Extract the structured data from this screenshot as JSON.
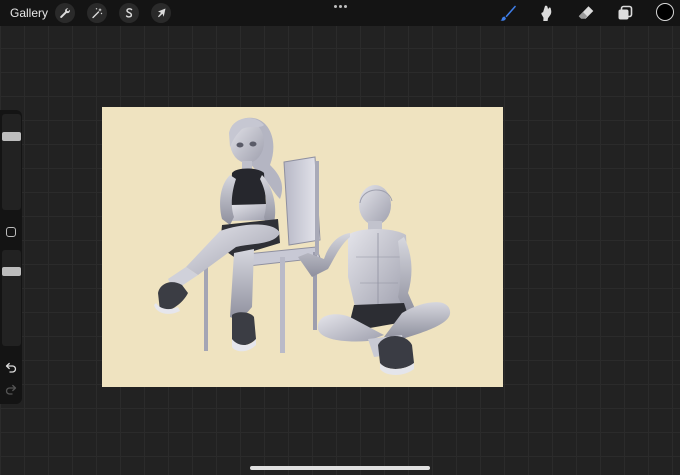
{
  "topbar": {
    "gallery_label": "Gallery",
    "left_tools": [
      {
        "name": "actions",
        "icon": "wrench-icon"
      },
      {
        "name": "adjustments",
        "icon": "magic-wand-icon"
      },
      {
        "name": "selection",
        "icon": "selection-s-icon"
      },
      {
        "name": "transform",
        "icon": "arrow-cursor-icon"
      }
    ],
    "more_icon": "more-dots-icon",
    "right_tools": [
      {
        "name": "brush",
        "icon": "brush-icon",
        "active": true
      },
      {
        "name": "smudge",
        "icon": "smudge-icon",
        "active": false
      },
      {
        "name": "eraser",
        "icon": "eraser-icon",
        "active": false
      },
      {
        "name": "layers",
        "icon": "layers-icon",
        "active": false
      }
    ],
    "current_color": "#000000",
    "active_tool_color": "#3f7ee8"
  },
  "sidebar": {
    "brush_size": 0.79,
    "brush_opacity": 0.8,
    "modify_icon": "square-modify-icon",
    "undo_icon": "undo-arrow-icon",
    "redo_icon": "redo-arrow-icon"
  },
  "canvas": {
    "background_color": "#efe3c0",
    "content": "3d-pose-models-girl-on-chair-and-boy-sitting"
  }
}
